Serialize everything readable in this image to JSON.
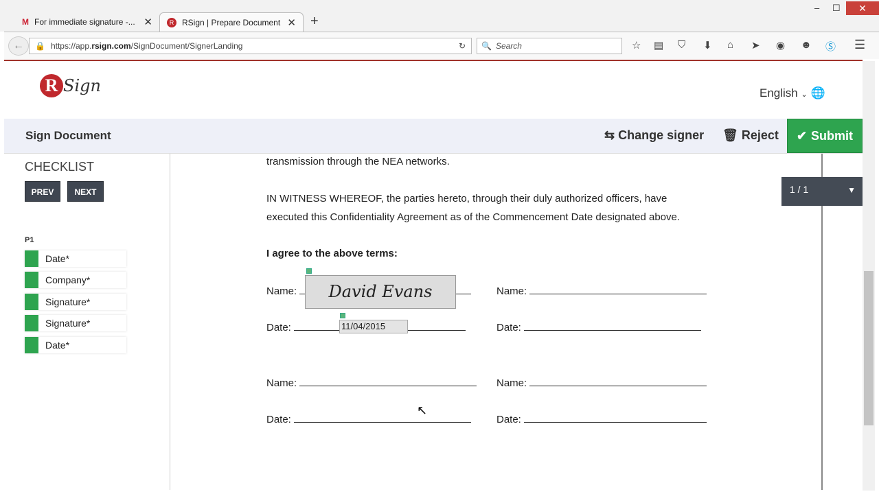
{
  "browser": {
    "tabs": [
      {
        "label": "For immediate signature -..."
      },
      {
        "label": "RSign | Prepare Document"
      }
    ],
    "url_prefix": "https://app.",
    "url_domain": "rsign.com",
    "url_path": "/SignDocument/SignerLanding",
    "search_placeholder": "Search"
  },
  "app": {
    "logo_text": "RSign",
    "language": "English",
    "page_title": "Sign Document",
    "change_signer": "Change signer",
    "reject": "Reject",
    "submit": "Submit"
  },
  "checklist": {
    "title": "CHECKLIST",
    "prev": "PREV",
    "next": "NEXT",
    "page": "P1",
    "items": [
      {
        "label": "Date*"
      },
      {
        "label": "Company*"
      },
      {
        "label": "Signature*"
      },
      {
        "label": "Signature*"
      },
      {
        "label": "Date*"
      }
    ]
  },
  "document": {
    "line1": "transmission through the NEA networks.",
    "para1": "IN WITNESS WHEREOF, the parties hereto, through their duly authorized officers, have",
    "para2": "executed this Confidentiality Agreement as of the Commencement Date designated above.",
    "agree": "I agree to the above terms:",
    "name_label": "Name:",
    "date_label": "Date:",
    "signature": "David Evans",
    "date_value": "11/04/2015"
  },
  "pager": {
    "label": "1 / 1"
  }
}
